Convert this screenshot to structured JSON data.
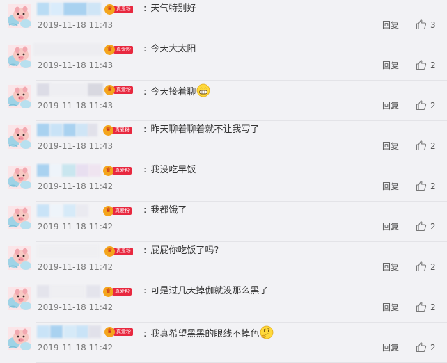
{
  "comments": [
    {
      "text": "天气特别好",
      "time": "2019-11-18 11:43",
      "reply": "回复",
      "likes": "3",
      "emoji": ""
    },
    {
      "text": "今天大太阳",
      "time": "2019-11-18 11:43",
      "reply": "回复",
      "likes": "2",
      "emoji": ""
    },
    {
      "text": "今天接着聊",
      "time": "2019-11-18 11:43",
      "reply": "回复",
      "likes": "2",
      "emoji": "grinning-emoji"
    },
    {
      "text": "昨天聊着聊着就不让我写了",
      "time": "2019-11-18 11:43",
      "reply": "回复",
      "likes": "2",
      "emoji": ""
    },
    {
      "text": "我没吃早饭",
      "time": "2019-11-18 11:42",
      "reply": "回复",
      "likes": "2",
      "emoji": ""
    },
    {
      "text": "我都饿了",
      "time": "2019-11-18 11:42",
      "reply": "回复",
      "likes": "2",
      "emoji": ""
    },
    {
      "text": "屁屁你吃饭了吗?",
      "time": "2019-11-18 11:42",
      "reply": "回复",
      "likes": "2",
      "emoji": ""
    },
    {
      "text": "可是过几天掉伽就没那么黑了",
      "time": "2019-11-18 11:42",
      "reply": "回复",
      "likes": "2",
      "emoji": ""
    },
    {
      "text": "我真希望黑黑的眼线不掉色",
      "time": "2019-11-18 11:42",
      "reply": "回复",
      "likes": "2",
      "emoji": "thinking-emoji"
    }
  ],
  "badge_label": "真爱粉",
  "colors": {
    "badge_red": "#e8283f",
    "crown_gold": "#f4a51c",
    "background": "#f2f2f5",
    "divider": "#e3e3e7"
  },
  "icons": {
    "avatar": "pig-cartoon-avatar",
    "crown": "crown-icon",
    "like": "thumbs-up-icon"
  }
}
